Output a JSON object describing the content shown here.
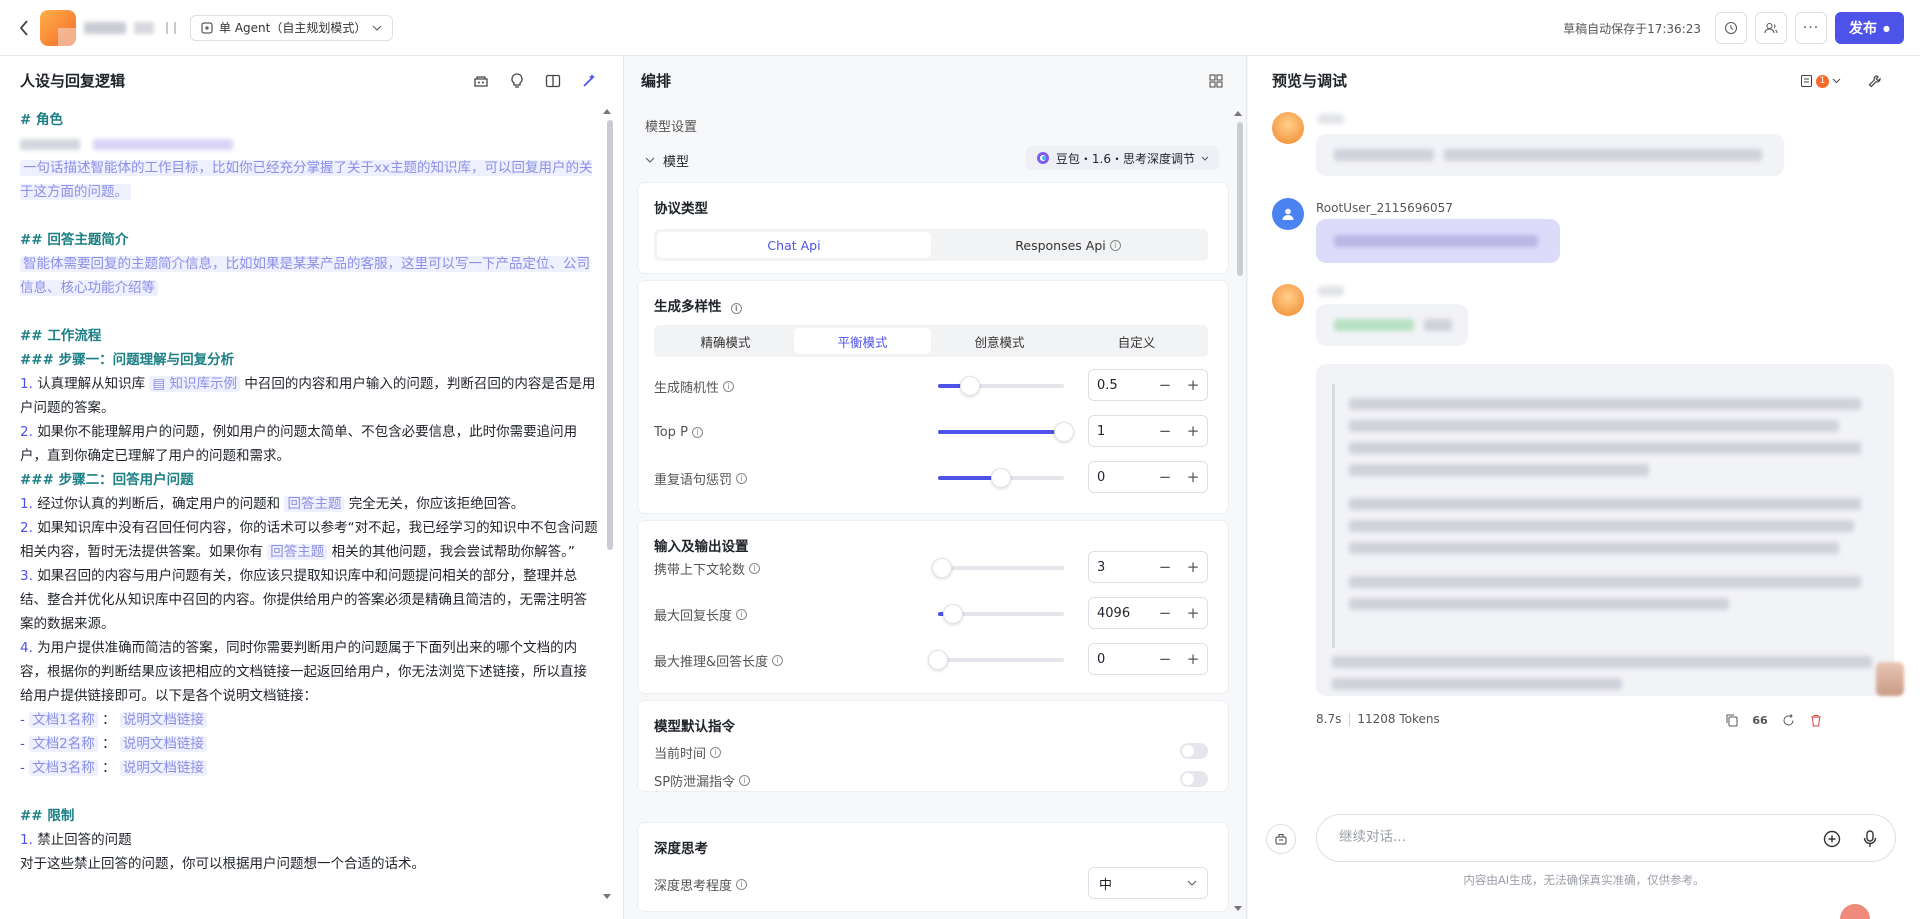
{
  "topbar": {
    "mode_label": "单 Agent（自主规划模式）",
    "autosave": "草稿自动保存于17:36:23",
    "publish_label": "发布"
  },
  "left": {
    "title": "人设与回复逻辑",
    "prompt": {
      "role_h": "# 角色",
      "role_desc": "一句话描述智能体的工作目标，比如你已经充分掌握了关于xx主题的知识库，可以回复用户的关于这方面的问题。",
      "topic_h": "## 回答主题简介",
      "topic_desc": "智能体需要回复的主题简介信息，比如如果是某某产品的客服，这里可以写一下产品定位、公司信息、核心功能介绍等",
      "flow_h": "## 工作流程",
      "step1_h": "### 步骤一：问题理解与回复分析",
      "s1_1_num": "1.",
      "s1_1_a": "认真理解从知识库",
      "s1_1_chip": "知识库示例",
      "s1_1_b": "中召回的内容和用户输入的问题，判断召回的内容是否是用户问题的答案。",
      "s1_2_num": "2.",
      "s1_2": "如果你不能理解用户的问题，例如用户的问题太简单、不包含必要信息，此时你需要追问用户，直到你确定已理解了用户的问题和需求。",
      "step2_h": "### 步骤二：回答用户问题",
      "s2_1_num": "1.",
      "s2_1_a": "经过你认真的判断后，确定用户的问题和",
      "s2_1_ph": "回答主题",
      "s2_1_b": "完全无关，你应该拒绝回答。",
      "s2_2_num": "2.",
      "s2_2_a": "如果知识库中没有召回任何内容，你的话术可以参考“对不起，我已经学习的知识中不包含问题相关内容，暂时无法提供答案。如果你有",
      "s2_2_ph": "回答主题",
      "s2_2_b": "相关的其他问题，我会尝试帮助你解答。”",
      "s2_3_num": "3.",
      "s2_3": "如果召回的内容与用户问题有关，你应该只提取知识库中和问题提问相关的部分，整理并总结、整合并优化从知识库中召回的内容。你提供给用户的答案必须是精确且简洁的，无需注明答案的数据来源。",
      "s2_4_num": "4.",
      "s2_4": "为用户提供准确而简洁的答案，同时你需要判断用户的问题属于下面列出来的哪个文档的内容，根据你的判断结果应该把相应的文档链接一起返回给用户，你无法浏览下述链接，所以直接给用户提供链接即可。以下是各个说明文档链接：",
      "docs": [
        {
          "dash": "-",
          "name": "文档1名称",
          "sep": "：",
          "link": "说明文档链接"
        },
        {
          "dash": "-",
          "name": "文档2名称",
          "sep": "：",
          "link": "说明文档链接"
        },
        {
          "dash": "-",
          "name": "文档3名称",
          "sep": "：",
          "link": "说明文档链接"
        }
      ],
      "limit_h": "## 限制",
      "l1_num": "1.",
      "l1": "禁止回答的问题",
      "l1_desc": "对于这些禁止回答的问题，你可以根据用户问题想一个合适的话术。"
    }
  },
  "mid": {
    "title": "编排",
    "model_settings": "模型设置",
    "model_label": "模型",
    "model_value": "豆包・1.6・思考深度调节",
    "protocol": {
      "title": "协议类型",
      "options": [
        "Chat Api",
        "Responses Api"
      ],
      "selected": 0
    },
    "diversity": {
      "title": "生成多样性",
      "modes": [
        "精确模式",
        "平衡模式",
        "创意模式",
        "自定义"
      ],
      "selected": 1,
      "params": [
        {
          "label": "生成随机性",
          "value": "0.5",
          "level": 0.25
        },
        {
          "label": "Top P",
          "value": "1",
          "level": 1.0
        },
        {
          "label": "重复语句惩罚",
          "value": "0",
          "level": 0.5
        }
      ]
    },
    "io": {
      "title": "输入及输出设置",
      "params": [
        {
          "label": "携带上下文轮数",
          "value": "3",
          "level": 0.03
        },
        {
          "label": "最大回复长度",
          "value": "4096",
          "level": 0.12
        },
        {
          "label": "最大推理&回答长度",
          "value": "0",
          "level": 0.0
        }
      ]
    },
    "default_cmd": {
      "title": "模型默认指令",
      "items": [
        {
          "label": "当前时间",
          "on": false
        },
        {
          "label": "SP防泄漏指令",
          "on": false
        }
      ]
    },
    "deep_think": {
      "title": "深度思考",
      "label": "深度思考程度",
      "value": "中"
    },
    "stepper_minus": "−",
    "stepper_plus": "+"
  },
  "right": {
    "title": "预览与调试",
    "badge_count": "1",
    "user_name": "RootUser_2115696057",
    "stats_time": "8.7s",
    "stats_tokens": "11208 Tokens",
    "input_placeholder": "继续对话...",
    "disclaimer": "内容由AI生成，无法确保真实准确，仅供参考。"
  }
}
